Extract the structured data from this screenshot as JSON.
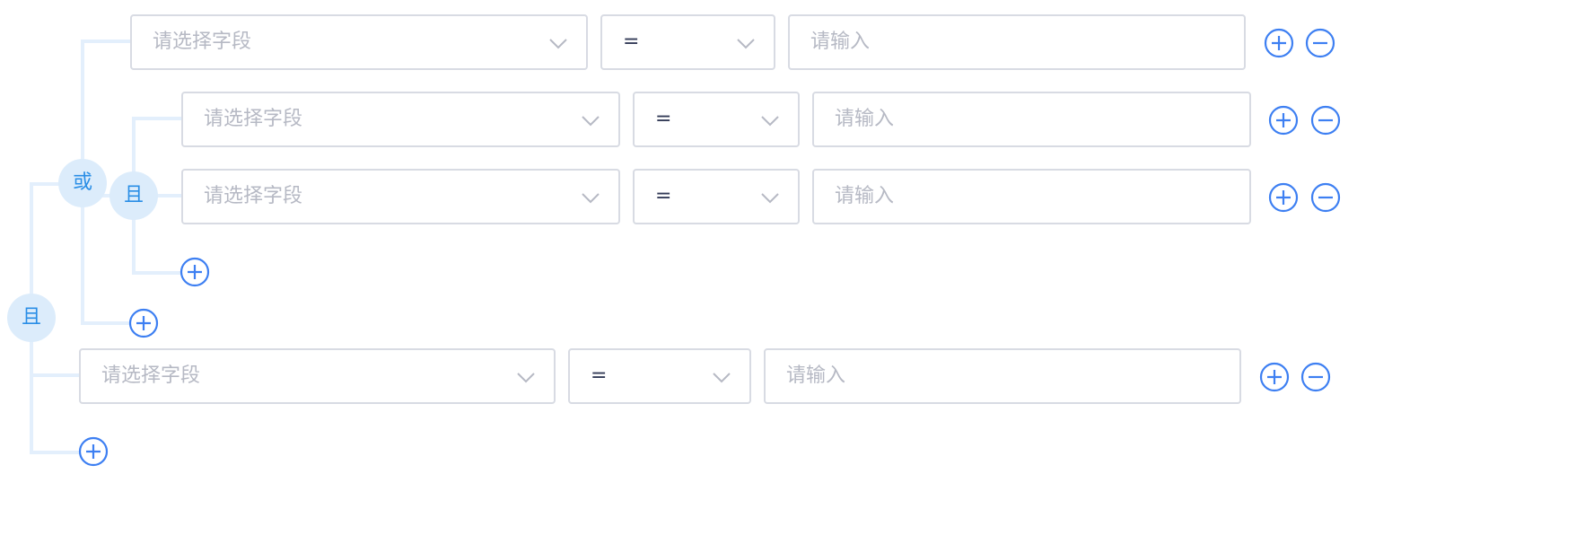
{
  "logic_labels": {
    "and": "且",
    "or": "或"
  },
  "placeholders": {
    "field": "请选择字段",
    "value": "请输入"
  },
  "operators": {
    "equals": "="
  },
  "icons": {
    "add": "plus-circle-icon",
    "remove": "minus-circle-icon",
    "dropdown": "chevron-down-icon"
  },
  "colors": {
    "accent": "#3d7ff2",
    "node_bg": "#dcecfb",
    "node_text": "#2a8ee6",
    "connector": "#e3effc",
    "border": "#d8dbe3",
    "placeholder": "#b6b9c4",
    "operator_text": "#333b57"
  },
  "conditions": [
    {
      "field": "",
      "operator": "=",
      "value": ""
    },
    {
      "field": "",
      "operator": "=",
      "value": ""
    },
    {
      "field": "",
      "operator": "=",
      "value": ""
    },
    {
      "field": "",
      "operator": "=",
      "value": ""
    }
  ]
}
